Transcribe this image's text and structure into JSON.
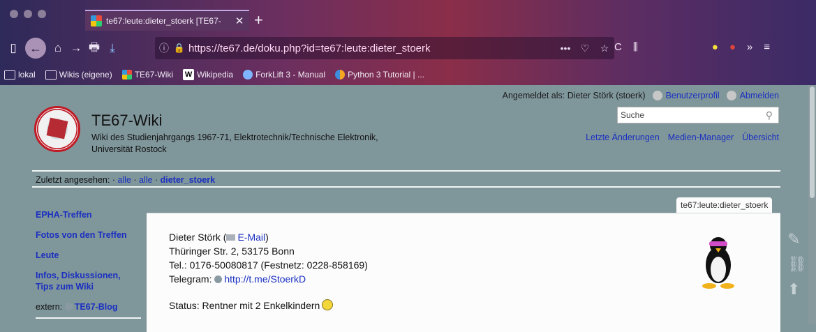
{
  "browser": {
    "tab_title": "te67:leute:dieter_stoerk [TE67-",
    "tab_close": "✕",
    "new_tab": "+",
    "url": "https://te67.de/doku.php?id=te67:leute:dieter_stoerk",
    "url_actions": [
      "•••",
      "♡",
      "☆"
    ],
    "nav_icons": [
      "▯",
      "←",
      "⌂",
      "→",
      "🖶",
      "⤓"
    ],
    "right_icons": [
      "C",
      "⫼",
      "●",
      "●",
      "»",
      "≡"
    ],
    "bookmarks": [
      {
        "label": "lokal",
        "icon": "folder-icon"
      },
      {
        "label": "Wikis (eigene)",
        "icon": "folder-icon"
      },
      {
        "label": "TE67-Wiki",
        "icon": "te67-favicon"
      },
      {
        "label": "Wikipedia",
        "icon": "wikipedia-icon"
      },
      {
        "label": "ForkLift 3 - Manual",
        "icon": "forklift-icon"
      },
      {
        "label": "Python 3 Tutorial | ...",
        "icon": "python-icon"
      }
    ]
  },
  "wiki": {
    "logged_in": "Angemeldet als: Dieter Störk (stoerk)",
    "profile": "Benutzerprofil",
    "logout": "Abmelden",
    "title": "TE67-Wiki",
    "subtitle": "Wiki des Studienjahrgangs 1967-71, Elektrotechnik/Technische Elektronik, Universität Rostock",
    "search_placeholder": "Suche",
    "toplinks": [
      "Letzte Änderungen",
      "Medien-Manager",
      "Übersicht"
    ],
    "trail_label": "Zuletzt angesehen:",
    "trail_items": [
      "alle",
      "alle",
      "dieter_stoerk"
    ],
    "sidebar": [
      "EPHA-Treffen",
      "Fotos von den Treffen",
      "Leute",
      "Infos, Diskussionen, Tips zum Wiki"
    ],
    "sidebar_extern_label": "extern:",
    "sidebar_extern_link": "TE67-Blog",
    "page_id": "te67:leute:dieter_stoerk",
    "content": {
      "name": "Dieter Störk (",
      "email": "E-Mail",
      "name_close": ")",
      "address": "Thüringer Str. 2, 53175 Bonn",
      "tel": "Tel.: 0176-50080817 (Festnetz: 0228-858169)",
      "telegram_label": "Telegram:",
      "telegram_link": "http://t.me/StoerkD",
      "status": "Status: Rentner mit 2 Enkelkindern"
    }
  }
}
